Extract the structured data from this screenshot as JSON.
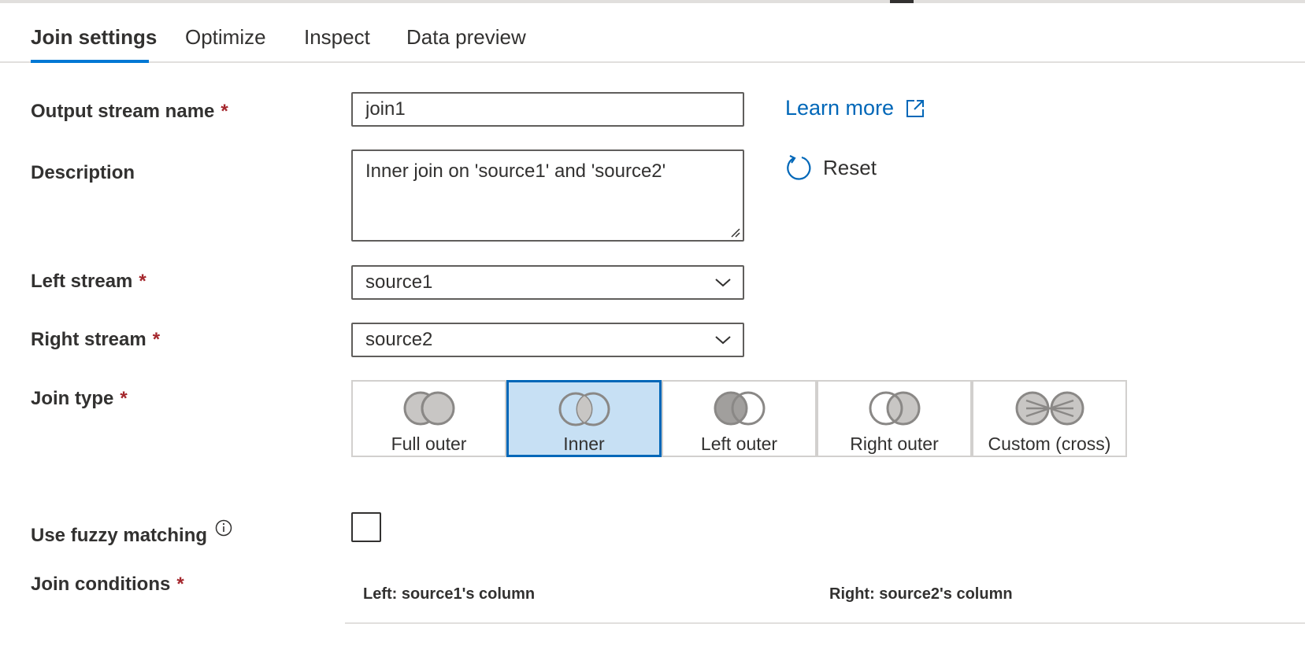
{
  "tabs": [
    {
      "label": "Join settings",
      "active": true
    },
    {
      "label": "Optimize",
      "active": false
    },
    {
      "label": "Inspect",
      "active": false
    },
    {
      "label": "Data preview",
      "active": false
    }
  ],
  "form": {
    "output_stream": {
      "label": "Output stream name",
      "required_mark": "*",
      "value": "join1"
    },
    "description": {
      "label": "Description",
      "value": "Inner join on 'source1' and 'source2'"
    },
    "left_stream": {
      "label": "Left stream",
      "required_mark": "*",
      "value": "source1"
    },
    "right_stream": {
      "label": "Right stream",
      "required_mark": "*",
      "value": "source2"
    },
    "join_type": {
      "label": "Join type",
      "required_mark": "*",
      "selected": "Inner",
      "options": [
        {
          "label": "Full outer",
          "icon": "full-outer-join-icon"
        },
        {
          "label": "Inner",
          "icon": "inner-join-icon"
        },
        {
          "label": "Left outer",
          "icon": "left-outer-join-icon"
        },
        {
          "label": "Right outer",
          "icon": "right-outer-join-icon"
        },
        {
          "label": "Custom (cross)",
          "icon": "cross-join-icon"
        }
      ]
    },
    "fuzzy": {
      "label": "Use fuzzy matching",
      "checked": false
    },
    "join_conditions": {
      "label": "Join conditions",
      "required_mark": "*",
      "left_header": "Left: source1's column",
      "right_header": "Right: source2's column"
    }
  },
  "links": {
    "learn_more": "Learn more",
    "reset": "Reset"
  },
  "colors": {
    "accent": "#0078d4",
    "link": "#0067b8",
    "required": "#a4262c",
    "selected_bg": "#c7e0f4"
  }
}
